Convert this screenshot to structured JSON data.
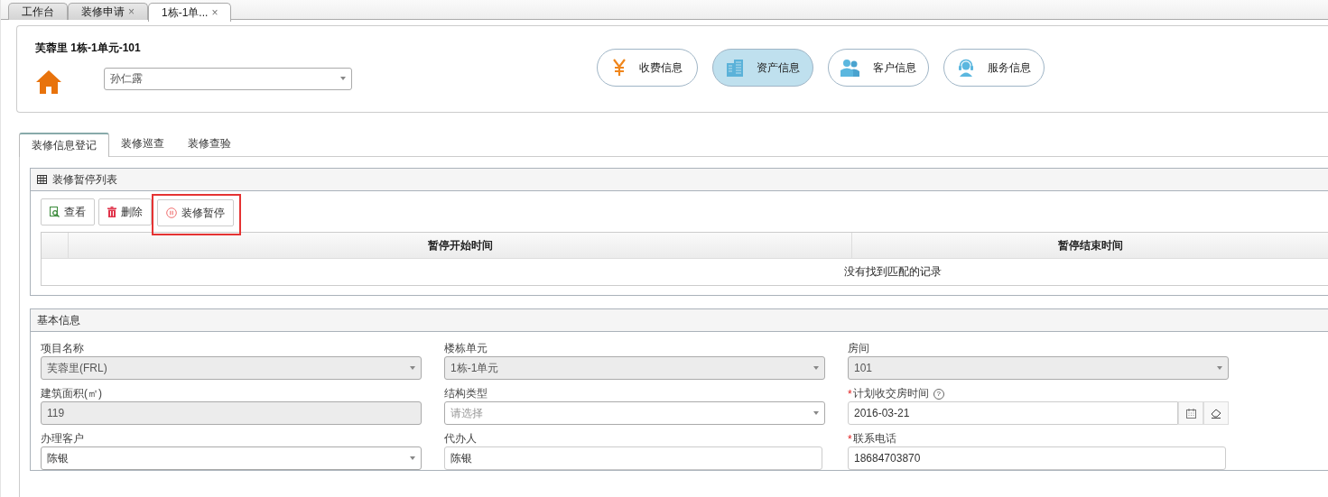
{
  "page_tabs": [
    {
      "label": "工作台",
      "selected": false
    },
    {
      "label": "装修申请",
      "close": "×",
      "selected": false
    },
    {
      "label": "1栋-1单...",
      "close": "×",
      "selected": true
    }
  ],
  "header": {
    "title": "芙蓉里 1栋-1单元-101",
    "customer_select": {
      "value": "孙仁露"
    },
    "nav_buttons": [
      {
        "label": "收费信息",
        "selected": false
      },
      {
        "label": "资产信息",
        "selected": true
      },
      {
        "label": "客户信息",
        "selected": false
      },
      {
        "label": "服务信息",
        "selected": false
      }
    ]
  },
  "tabs": [
    {
      "label": "装修信息登记",
      "selected": true
    },
    {
      "label": "装修巡查",
      "selected": false
    },
    {
      "label": "装修查验",
      "selected": false
    }
  ],
  "pause_list": {
    "title": "装修暂停列表",
    "toolbar": [
      {
        "label": "查看",
        "highlighted": false
      },
      {
        "label": "删除",
        "highlighted": false
      },
      {
        "label": "装修暂停",
        "highlighted": true
      }
    ],
    "table": {
      "columns": [
        "暂停开始时间",
        "暂停结束时间"
      ],
      "empty_message": "没有找到匹配的记录"
    }
  },
  "basic_info": {
    "title": "基本信息",
    "fields": [
      {
        "label": "项目名称",
        "kind": "select",
        "value": "芙蓉里(FRL)",
        "disabled": true
      },
      {
        "label": "楼栋单元",
        "kind": "select",
        "value": "1栋-1单元",
        "disabled": true
      },
      {
        "label": "房间",
        "kind": "select",
        "value": "101",
        "disabled": true
      },
      {
        "label": "建筑面积(㎡)",
        "kind": "input",
        "value": "119",
        "disabled": true
      },
      {
        "label": "结构类型",
        "kind": "select",
        "placeholder": "请选择",
        "disabled": false
      },
      {
        "label": "计划收交房时间",
        "kind": "date",
        "value": "2016-03-21",
        "disabled": false,
        "required_mark": "*",
        "help_mark": "?"
      },
      {
        "label": "办理客户",
        "kind": "select",
        "value": "陈银",
        "disabled": false
      },
      {
        "label": "代办人",
        "kind": "input",
        "value": "陈银",
        "disabled": false
      },
      {
        "label": "联系电话",
        "kind": "input",
        "value": "18684703870",
        "disabled": false,
        "required_mark": "*"
      }
    ]
  }
}
